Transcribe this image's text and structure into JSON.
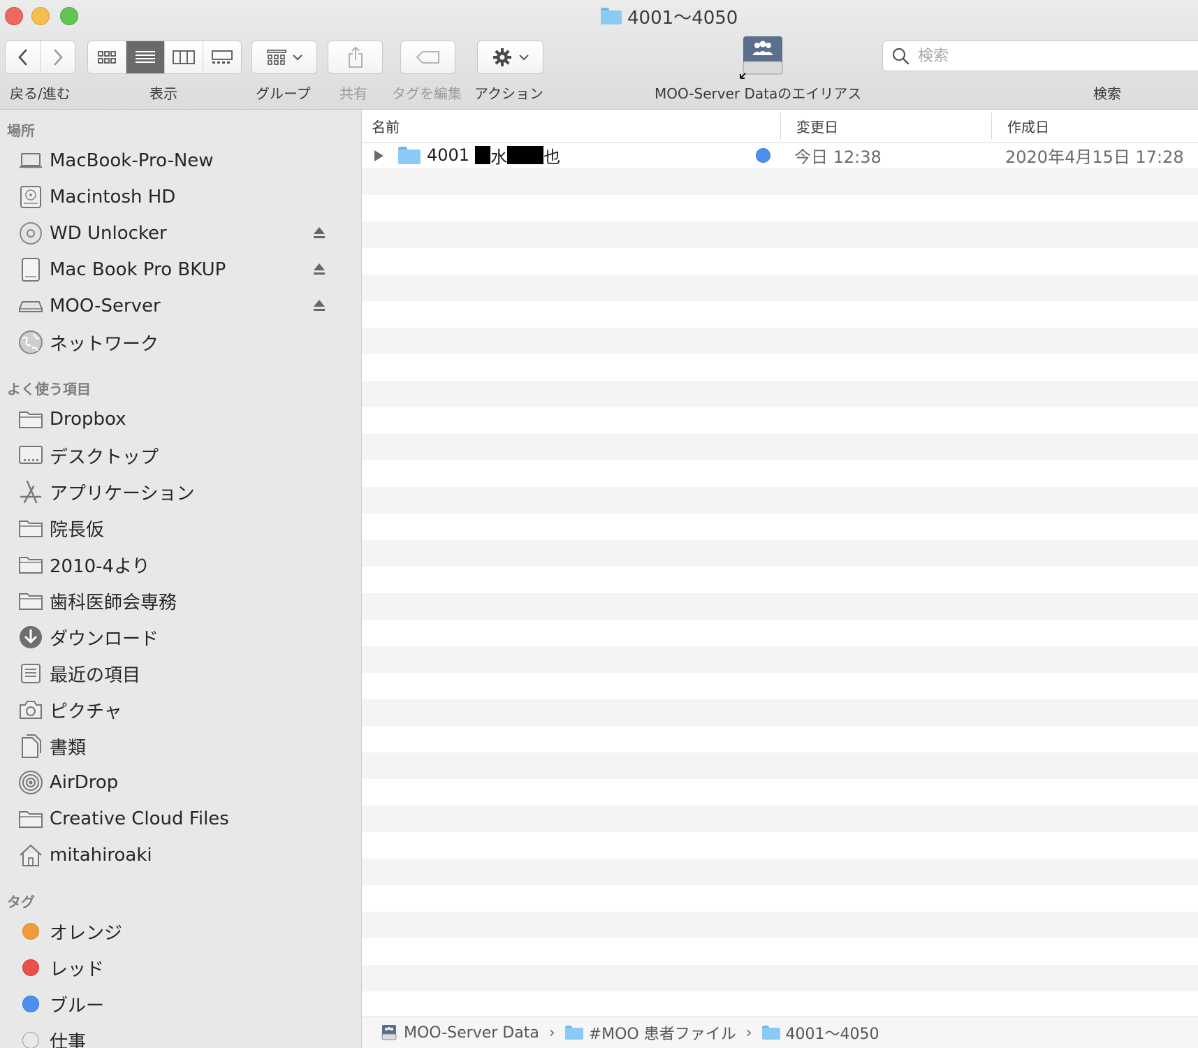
{
  "window": {
    "title": "4001〜4050"
  },
  "toolbar": {
    "nav_label": "戻る/進む",
    "view_label": "表示",
    "group_label": "グループ",
    "share_label": "共有",
    "tags_label": "タグを編集",
    "action_label": "アクション",
    "alias_label": "MOO-Server Dataのエイリアス",
    "search_label": "検索",
    "search_placeholder": "検索"
  },
  "sidebar": {
    "locations_header": "場所",
    "locations": [
      {
        "label": "MacBook-Pro-New",
        "icon": "laptop-icon"
      },
      {
        "label": "Macintosh HD",
        "icon": "hard-drive-icon"
      },
      {
        "label": "WD Unlocker",
        "icon": "disc-icon",
        "eject": true
      },
      {
        "label": "Mac Book Pro BKUP",
        "icon": "external-drive-icon",
        "eject": true
      },
      {
        "label": "MOO-Server",
        "icon": "server-icon",
        "eject": true
      },
      {
        "label": "ネットワーク",
        "icon": "network-globe-icon"
      }
    ],
    "favorites_header": "よく使う項目",
    "favorites": [
      {
        "label": "Dropbox",
        "icon": "folder-icon"
      },
      {
        "label": "デスクトップ",
        "icon": "desktop-icon"
      },
      {
        "label": "アプリケーション",
        "icon": "applications-icon"
      },
      {
        "label": "院長仮",
        "icon": "folder-icon"
      },
      {
        "label": "2010-4より",
        "icon": "folder-icon"
      },
      {
        "label": "歯科医師会専務",
        "icon": "folder-icon"
      },
      {
        "label": "ダウンロード",
        "icon": "download-icon"
      },
      {
        "label": "最近の項目",
        "icon": "recents-icon"
      },
      {
        "label": "ピクチャ",
        "icon": "camera-icon"
      },
      {
        "label": "書類",
        "icon": "documents-icon"
      },
      {
        "label": "AirDrop",
        "icon": "airdrop-icon"
      },
      {
        "label": "Creative Cloud Files",
        "icon": "folder-icon"
      },
      {
        "label": "mitahiroaki",
        "icon": "home-icon"
      }
    ],
    "tags_header": "タグ",
    "tags": [
      {
        "label": "オレンジ",
        "color": "#f19a3e"
      },
      {
        "label": "レッド",
        "color": "#ec4f4a"
      },
      {
        "label": "ブルー",
        "color": "#4b8ff0"
      },
      {
        "label": "仕事",
        "color": "#e9e9e9"
      }
    ]
  },
  "columns": {
    "name": "名前",
    "modified": "変更日",
    "created": "作成日"
  },
  "files": [
    {
      "name_prefix": "4001",
      "name_visible_1": "水",
      "name_visible_2": "也",
      "tag_color": "#4b8ff0",
      "modified": "今日 12:38",
      "created": "2020年4月15日 17:28"
    }
  ],
  "pathbar": {
    "items": [
      "MOO-Server Data",
      "#MOO 患者ファイル",
      "4001〜4050"
    ],
    "separator": "›"
  }
}
